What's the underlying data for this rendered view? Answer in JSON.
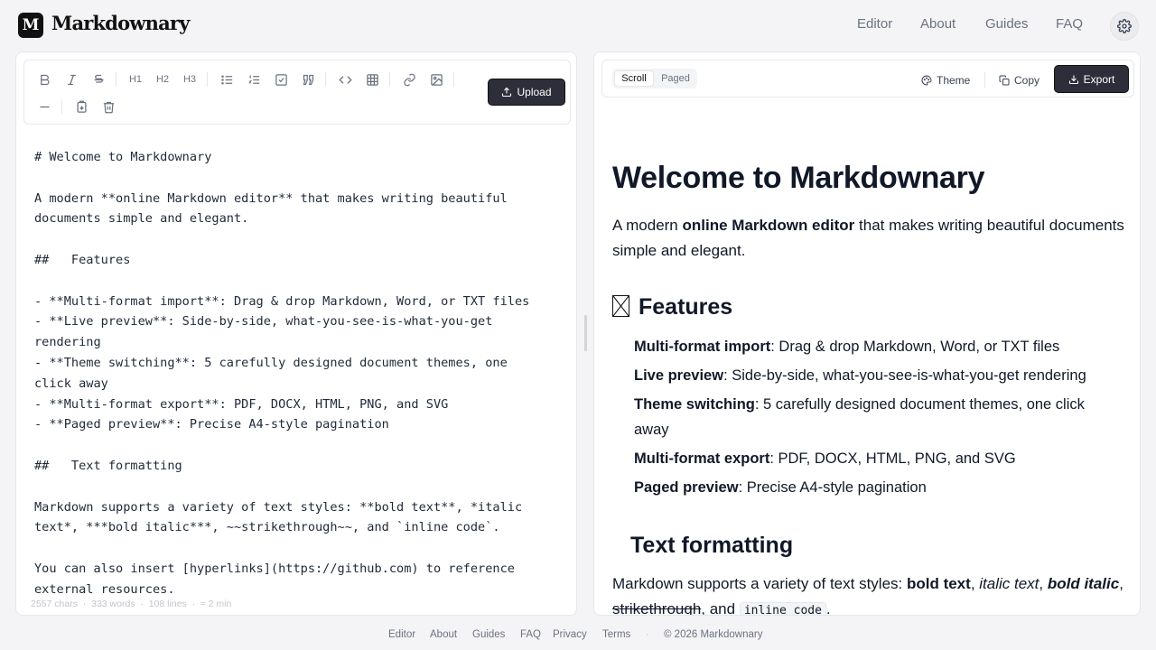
{
  "app": {
    "logo_letter": "M",
    "name": "Markdownary"
  },
  "nav": [
    "Editor",
    "About",
    "Guides",
    "FAQ"
  ],
  "toolbar": {
    "heading_labels": [
      "H1",
      "H2",
      "H3"
    ],
    "upload_label": "Upload",
    "icons": [
      "bold-icon",
      "italic-icon",
      "strikethrough-icon",
      "h1",
      "h2",
      "h3",
      "bullet-list-icon",
      "numbered-list-icon",
      "task-list-icon",
      "quote-icon",
      "code-icon",
      "table-icon",
      "link-icon",
      "image-icon",
      "horizontal-rule-icon",
      "copy-document-icon",
      "trash-icon"
    ]
  },
  "editor": {
    "lines": [
      "# Welcome to Markdownary",
      "",
      "A modern **online Markdown editor** that makes writing beautiful",
      "documents simple and elegant.",
      "",
      "##   Features",
      "",
      "- **Multi-format import**: Drag & drop Markdown, Word, or TXT files",
      "- **Live preview**: Side-by-side, what-you-see-is-what-you-get",
      "rendering",
      "- **Theme switching**: 5 carefully designed document themes, one",
      "click away",
      "- **Multi-format export**: PDF, DOCX, HTML, PNG, and SVG",
      "- **Paged preview**: Precise A4-style pagination",
      "",
      "##   Text formatting",
      "",
      "Markdown supports a variety of text styles: **bold text**, *italic",
      "text*, ***bold italic***, ~~strikethrough~~, and `inline code`.",
      "",
      "You can also insert [hyperlinks](https://github.com) to reference",
      "external resources."
    ],
    "status": {
      "chars": "2557 chars",
      "words": "333 words",
      "lines": "108 lines",
      "time": "≈ 2 min"
    }
  },
  "preview_toolbar": {
    "mode_scroll": "Scroll",
    "mode_paged": "Paged",
    "active_mode": "Scroll",
    "theme_label": "Theme",
    "copy_label": "Copy",
    "export_label": "Export"
  },
  "preview": {
    "h1": "Welcome to Markdownary",
    "intro_pre": "A modern ",
    "intro_bold": "online Markdown editor",
    "intro_post": " that makes writing beautiful documents simple and elegant.",
    "features_heading": "Features",
    "features": [
      {
        "term": "Multi-format import",
        "desc": ": Drag & drop Markdown, Word, or TXT files"
      },
      {
        "term": "Live preview",
        "desc": ": Side-by-side, what-you-see-is-what-you-get rendering"
      },
      {
        "term": "Theme switching",
        "desc": ": 5 carefully designed document themes, one click away"
      },
      {
        "term": "Multi-format export",
        "desc": ": PDF, DOCX, HTML, PNG, and SVG"
      },
      {
        "term": "Paged preview",
        "desc": ": Precise A4-style pagination"
      }
    ],
    "text_formatting_heading": "Text formatting",
    "tf_pre": "Markdown supports a variety of text styles: ",
    "tf_bold": "bold text",
    "tf_sep1": ", ",
    "tf_italic": "italic text",
    "tf_sep2": ", ",
    "tf_bolditalic": "bold italic",
    "tf_sep3": ", ",
    "tf_strike": "strikethrough",
    "tf_sep4": ", and ",
    "tf_code": "inline code",
    "tf_end": "."
  },
  "footer": {
    "links": [
      "Editor",
      "About",
      "Guides",
      "FAQ",
      "Privacy",
      "Terms"
    ],
    "separator": "·",
    "copyright": "© 2026 Markdownary"
  },
  "colors": {
    "primary_button": "#2e2e3a",
    "background": "#f4f4f6",
    "text": "#111827",
    "muted": "#6b7280"
  }
}
